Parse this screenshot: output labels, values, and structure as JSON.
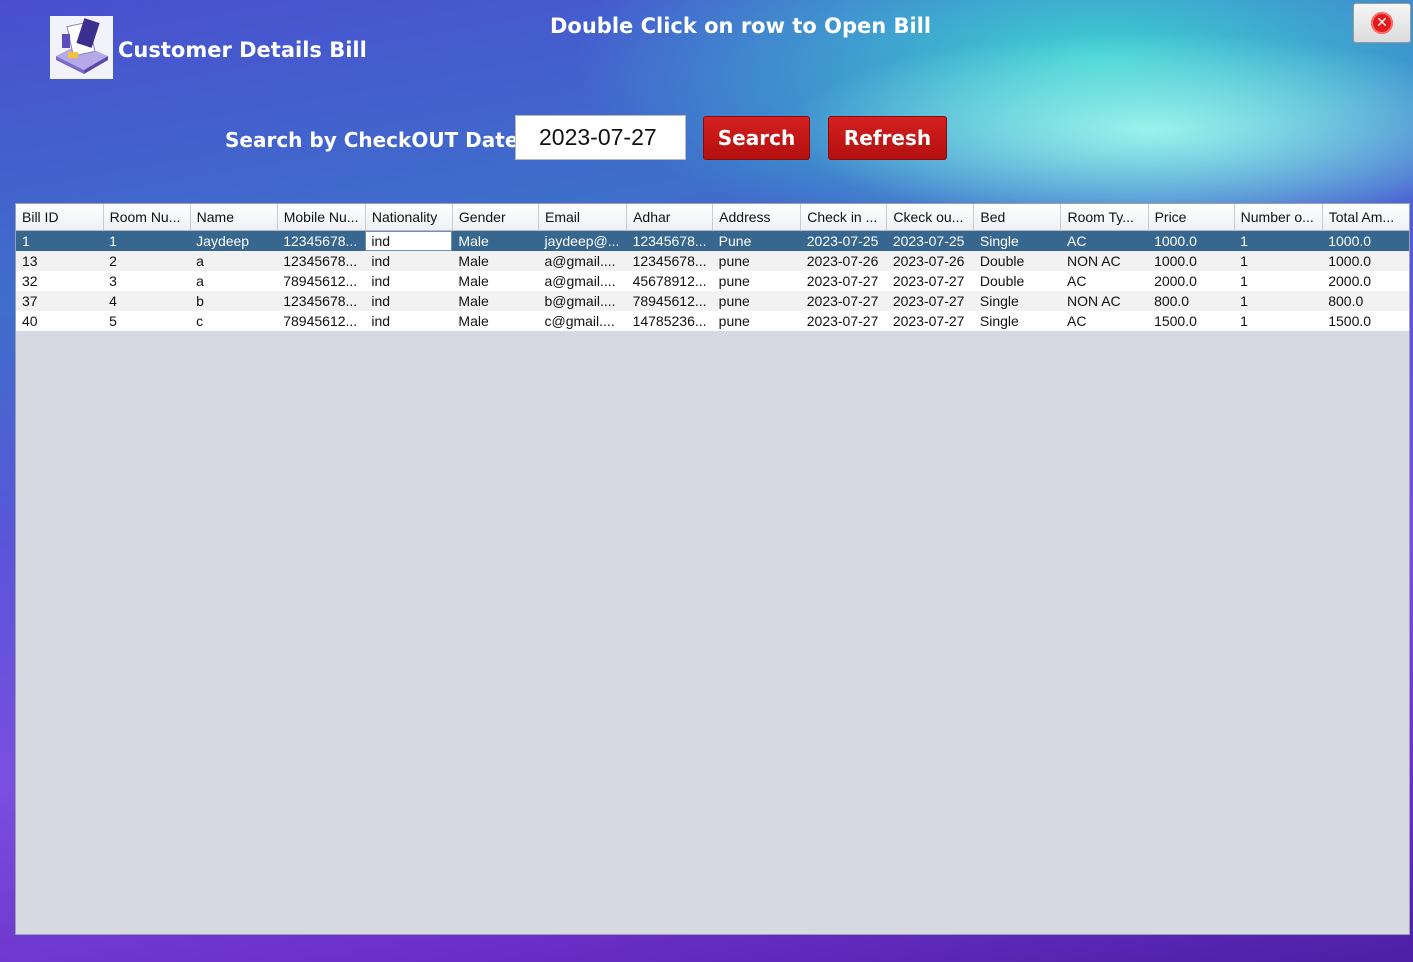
{
  "app": {
    "title": "Customer Details Bill",
    "hint": "Double Click on row to Open Bill",
    "close_icon": "close-icon"
  },
  "search": {
    "label": "Search by CheckOUT Date",
    "date_value": "2023-07-27",
    "search_label": "Search",
    "refresh_label": "Refresh"
  },
  "table": {
    "columns": [
      "Bill ID",
      "Room Nu...",
      "Name",
      "Mobile Nu...",
      "Nationality",
      "Gender",
      "Email",
      "Adhar",
      "Address",
      "Check in ...",
      "Ckeck ou...",
      "Bed",
      "Room Ty...",
      "Price",
      "Number o...",
      "Total Am..."
    ],
    "rows": [
      [
        "1",
        "1",
        "Jaydeep",
        "12345678...",
        "ind",
        "Male",
        "jaydeep@...",
        "12345678...",
        "Pune",
        "2023-07-25",
        "2023-07-25",
        "Single",
        "AC",
        "1000.0",
        "1",
        "1000.0"
      ],
      [
        "13",
        "2",
        "a",
        "12345678...",
        "ind",
        "Male",
        "a@gmail....",
        "12345678...",
        "pune",
        "2023-07-26",
        "2023-07-26",
        "Double",
        "NON AC",
        "1000.0",
        "1",
        "1000.0"
      ],
      [
        "32",
        "3",
        "a",
        "78945612...",
        "ind",
        "Male",
        "a@gmail....",
        "45678912...",
        "pune",
        "2023-07-27",
        "2023-07-27",
        "Double",
        "AC",
        "2000.0",
        "1",
        "2000.0"
      ],
      [
        "37",
        "4",
        "b",
        "12345678...",
        "ind",
        "Male",
        "b@gmail....",
        "78945612...",
        "pune",
        "2023-07-27",
        "2023-07-27",
        "Single",
        "NON AC",
        "800.0",
        "1",
        "800.0"
      ],
      [
        "40",
        "5",
        "c",
        "78945612...",
        "ind",
        "Male",
        "c@gmail....",
        "14785236...",
        "pune",
        "2023-07-27",
        "2023-07-27",
        "Single",
        "AC",
        "1500.0",
        "1",
        "1500.0"
      ]
    ],
    "selected_row": 0
  },
  "colors": {
    "button_red": "#c81818",
    "selection": "#37668e"
  }
}
